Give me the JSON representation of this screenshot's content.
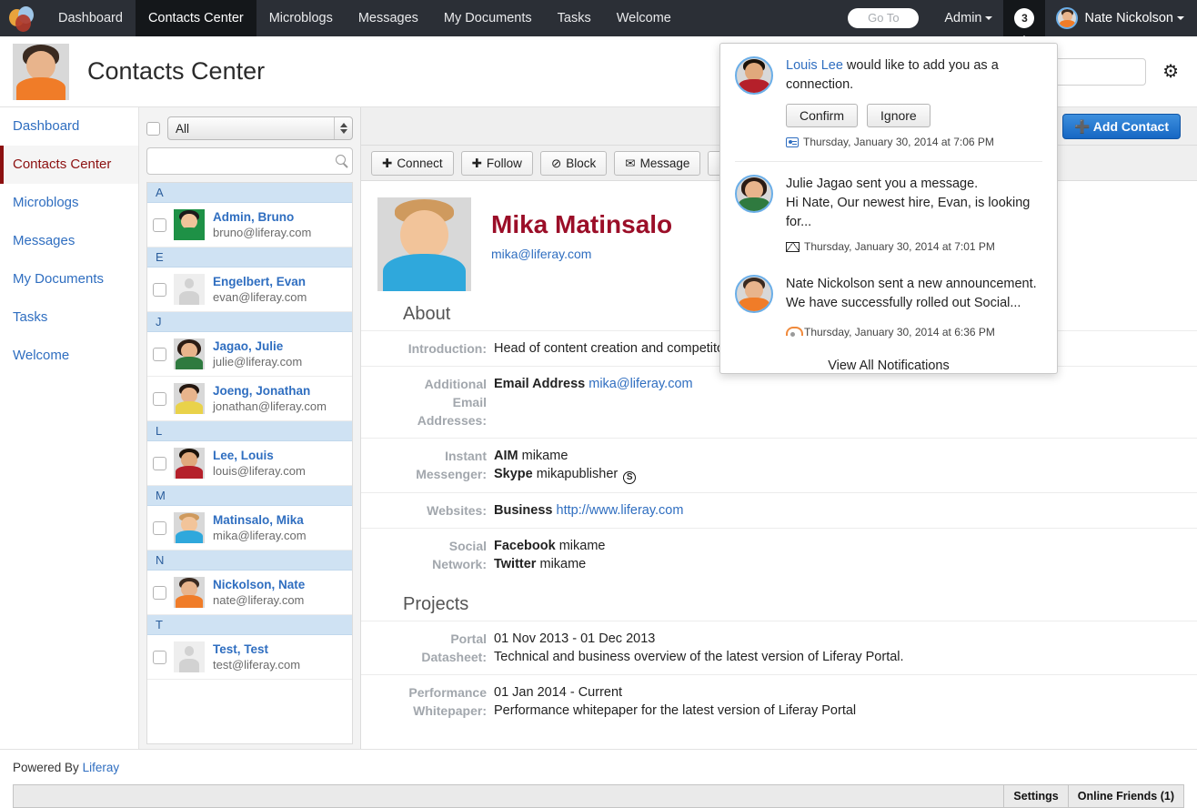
{
  "topnav": {
    "logo_name": "liferay-logo",
    "items": [
      {
        "label": "Dashboard",
        "active": false
      },
      {
        "label": "Contacts Center",
        "active": true
      },
      {
        "label": "Microblogs",
        "active": false
      },
      {
        "label": "Messages",
        "active": false
      },
      {
        "label": "My Documents",
        "active": false
      },
      {
        "label": "Tasks",
        "active": false
      },
      {
        "label": "Welcome",
        "active": false
      }
    ],
    "goto_label": "Go To",
    "admin_label": "Admin",
    "notification_count": "3",
    "user_name": "Nate Nickolson"
  },
  "siteheader": {
    "title": "Contacts Center",
    "search_placeholder": "",
    "search_value": "",
    "gear_icon": "gear-icon"
  },
  "leftnav": {
    "items": [
      {
        "label": "Dashboard",
        "active": false
      },
      {
        "label": "Contacts Center",
        "active": true
      },
      {
        "label": "Microblogs",
        "active": false
      },
      {
        "label": "Messages",
        "active": false
      },
      {
        "label": "My Documents",
        "active": false
      },
      {
        "label": "Tasks",
        "active": false
      },
      {
        "label": "Welcome",
        "active": false
      }
    ]
  },
  "contacts_panel": {
    "filter_selected": "All",
    "filter_options": [
      "All"
    ],
    "search_value": "",
    "search_placeholder": "",
    "groups": [
      {
        "letter": "A",
        "contacts": [
          {
            "name": "Admin, Bruno",
            "email": "bruno@liferay.com",
            "avatar": "avatar-bruno"
          }
        ]
      },
      {
        "letter": "E",
        "contacts": [
          {
            "name": "Engelbert, Evan",
            "email": "evan@liferay.com",
            "avatar": "avatar-placeholder"
          }
        ]
      },
      {
        "letter": "J",
        "contacts": [
          {
            "name": "Jagao, Julie",
            "email": "julie@liferay.com",
            "avatar": "avatar-julie"
          },
          {
            "name": "Joeng, Jonathan",
            "email": "jonathan@liferay.com",
            "avatar": "avatar-jonathan"
          }
        ]
      },
      {
        "letter": "L",
        "contacts": [
          {
            "name": "Lee, Louis",
            "email": "louis@liferay.com",
            "avatar": "avatar-louis"
          }
        ]
      },
      {
        "letter": "M",
        "contacts": [
          {
            "name": "Matinsalo, Mika",
            "email": "mika@liferay.com",
            "avatar": "avatar-mika"
          }
        ]
      },
      {
        "letter": "N",
        "contacts": [
          {
            "name": "Nickolson, Nate",
            "email": "nate@liferay.com",
            "avatar": "avatar-nate"
          }
        ]
      },
      {
        "letter": "T",
        "contacts": [
          {
            "name": "Test, Test",
            "email": "test@liferay.com",
            "avatar": "avatar-placeholder"
          }
        ]
      }
    ]
  },
  "main": {
    "add_contact_label": "Add Contact",
    "toolbar": [
      {
        "label": "Connect",
        "icon": "plus-circle-icon"
      },
      {
        "label": "Follow",
        "icon": "plus-circle-icon"
      },
      {
        "label": "Block",
        "icon": "block-icon"
      },
      {
        "label": "Message",
        "icon": "envelope-icon"
      },
      {
        "label": "",
        "icon": "save-disk-icon"
      }
    ],
    "profile": {
      "name": "Mika Matinsalo",
      "email": "mika@liferay.com",
      "sections": [
        {
          "heading": "About",
          "rows": [
            {
              "label": "Introduction:",
              "value": "Head of content creation and competitor a"
            },
            {
              "label": "Additional Email Addresses:",
              "value_bold": "Email Address",
              "value_link": "mika@liferay.com"
            },
            {
              "label": "Instant Messenger:",
              "lines": [
                {
                  "bold": "AIM",
                  "text": "mikame"
                },
                {
                  "bold": "Skype",
                  "text": "mikapublisher",
                  "badge": "S"
                }
              ]
            },
            {
              "label": "Websites:",
              "value_bold": "Business",
              "value_link": "http://www.liferay.com"
            },
            {
              "label": "Social Network:",
              "lines": [
                {
                  "bold": "Facebook",
                  "text": "mikame"
                },
                {
                  "bold": "Twitter",
                  "text": "mikame"
                }
              ]
            }
          ]
        },
        {
          "heading": "Projects",
          "rows": [
            {
              "label": "Portal Datasheet:",
              "lines_plain": [
                "01 Nov 2013 - 01 Dec 2013",
                "Technical and business overview of the latest version of Liferay Portal."
              ]
            },
            {
              "label": "Performance Whitepaper:",
              "lines_plain": [
                "01 Jan 2014 - Current",
                "Performance whitepaper for the latest version of Liferay Portal"
              ]
            }
          ]
        }
      ]
    }
  },
  "notifications": {
    "items": [
      {
        "avatar": "avatar-louis",
        "actor": "Louis Lee",
        "text": " would like to add you as a connection.",
        "confirm_label": "Confirm",
        "ignore_label": "Ignore",
        "time": "Thursday, January 30, 2014 at 7:06 PM",
        "time_icon": "contact-card-icon"
      },
      {
        "avatar": "avatar-julie",
        "actor": "",
        "text": "Julie Jagao sent you a message.",
        "preview": "Hi Nate, Our newest hire, Evan, is looking for...",
        "time": "Thursday, January 30, 2014 at 7:01 PM",
        "time_icon": "envelope-icon"
      },
      {
        "avatar": "avatar-nate",
        "actor": "",
        "text": "Nate Nickolson sent a new announcement.",
        "preview": "We have successfully rolled out Social...",
        "time": "Thursday, January 30, 2014 at 6:36 PM",
        "time_icon": "announcement-icon"
      }
    ],
    "view_all_label": "View All Notifications"
  },
  "footer": {
    "powered_by": "Powered By",
    "brand": "Liferay",
    "settings_label": "Settings",
    "online_friends_label": "Online Friends (1)"
  },
  "colors": {
    "topbar_bg": "#2b2f36",
    "topbar_active": "#14171a",
    "link_blue": "#2f6ec0",
    "accent_red": "#8c1010",
    "profile_name": "#9b0e28",
    "group_header": "#cfe2f3",
    "button_blue": "#1667c4"
  }
}
